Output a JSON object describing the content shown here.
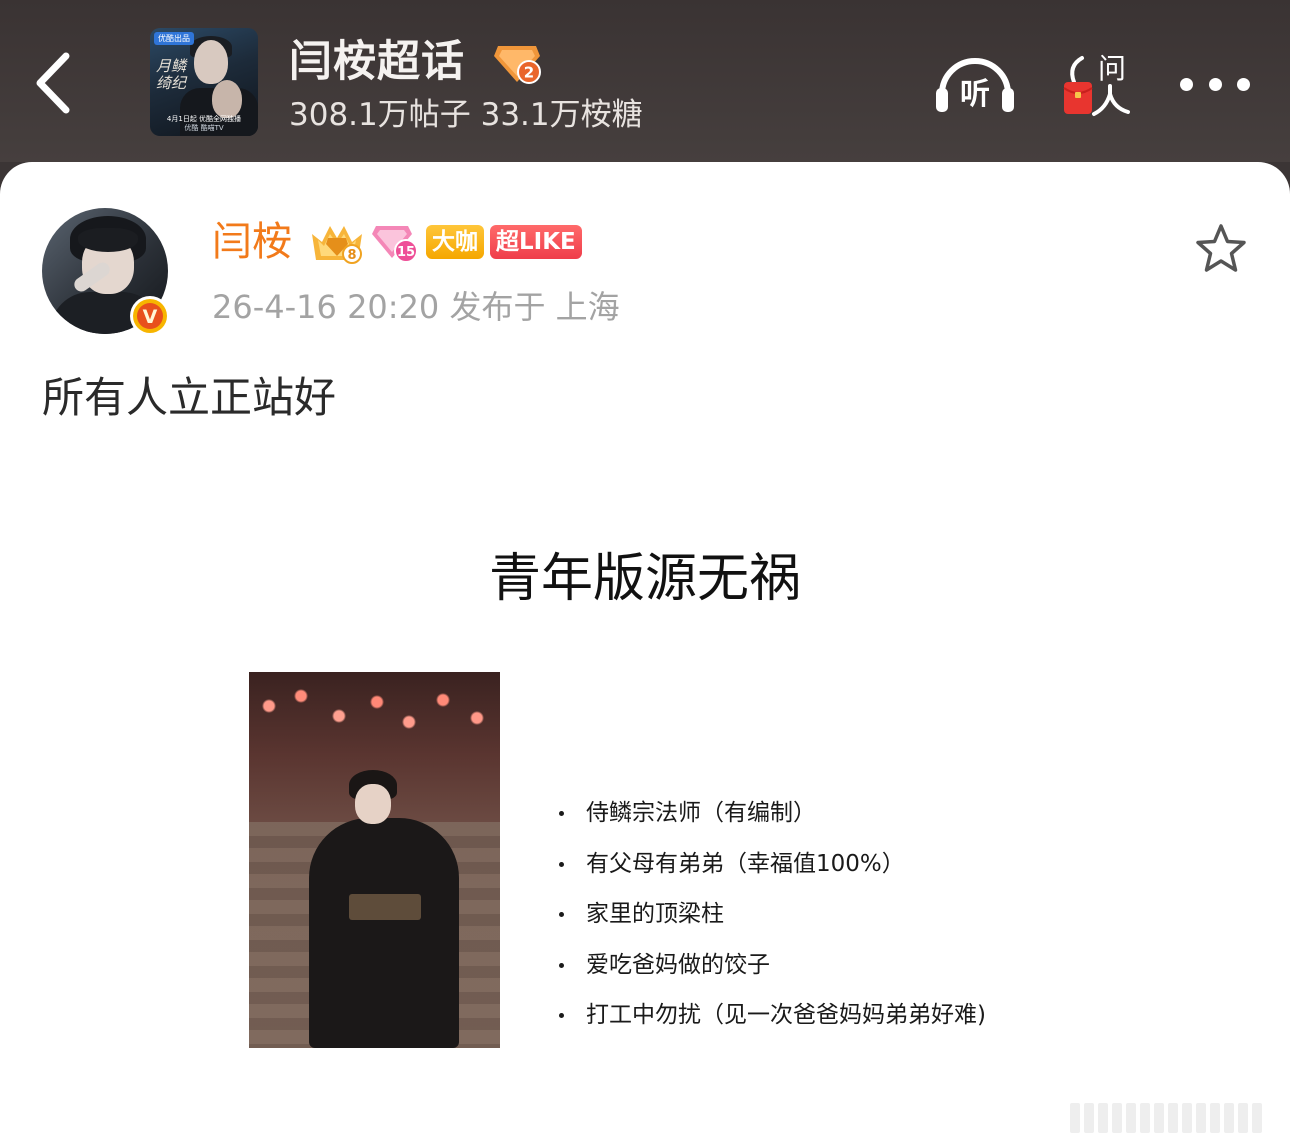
{
  "header": {
    "back_icon": "chevron-left-icon",
    "cover_image": {
      "tag": "优酷出品",
      "title": "月鳞绮纪",
      "date_line": "4月1日起 优酷全网独播",
      "platforms": "优酷 酷喵TV"
    },
    "title": "闫桉超话",
    "level_badge": "2",
    "stats": "308.1万帖子 33.1万桉糖",
    "listen_icon": "headphones-icon",
    "listen_label": "听",
    "ask_label": "问",
    "more_icon": "more-dots-icon"
  },
  "post": {
    "author": "闫桉",
    "crown_level": "8",
    "fan_level": "15",
    "badge_daka": "大咖",
    "badge_like": "超LIKE",
    "verified_mark": "V",
    "meta": "26-4-16 20:20  发布于 上海",
    "favorite_icon": "star-outline-icon",
    "text": "所有人立正站好",
    "image": {
      "heading": "青年版源无祸",
      "bullets": [
        "侍鳞宗法师（有编制）",
        "有父母有弟弟（幸福值100%）",
        "家里的顶梁柱",
        "爱吃爸妈做的饺子",
        "打工中勿扰（见一次爸爸妈妈弟弟好难)"
      ]
    }
  },
  "colors": {
    "header_bg": "#3b3535",
    "username": "#f27a1a",
    "meta_text": "#a3a3a3",
    "badge_daka": "#f5a700",
    "badge_like": "#ef3d4a"
  }
}
